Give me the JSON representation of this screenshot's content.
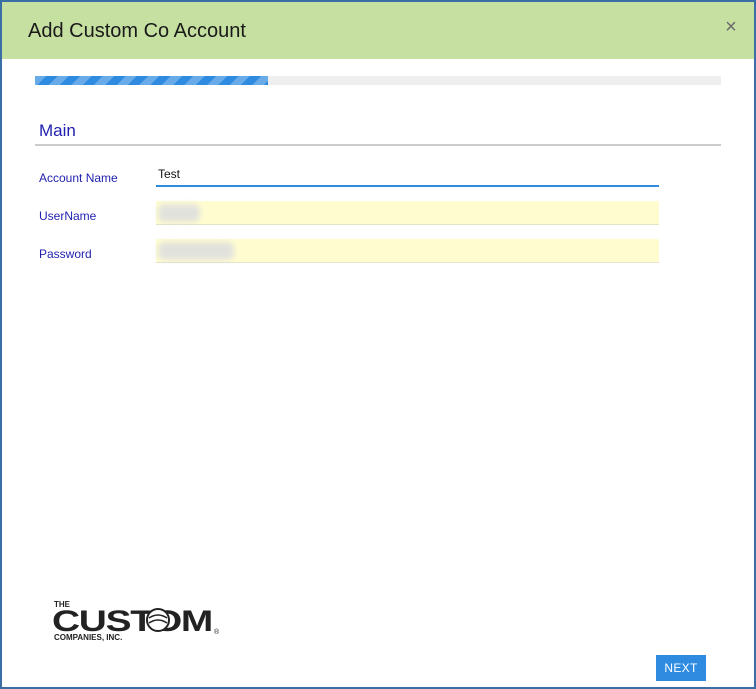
{
  "dialog": {
    "title": "Add Custom Co Account",
    "close_symbol": "×",
    "progress": 0.34
  },
  "section": {
    "title": "Main"
  },
  "form": {
    "account_name": {
      "label": "Account Name",
      "value": "Test"
    },
    "username": {
      "label": "UserName",
      "value": ""
    },
    "password": {
      "label": "Password",
      "value": ""
    }
  },
  "logo": {
    "line1": "THE",
    "line2": "CUSTOM",
    "line3": "COMPANIES, INC.",
    "mark": "®"
  },
  "footer": {
    "next_label": "NEXT"
  },
  "colors": {
    "header_bg": "#c5e0a0",
    "accent": "#2f8be0",
    "label": "#1f1fb0",
    "autofill_bg": "#fffdd0"
  },
  "icons": {
    "close": "close-icon"
  }
}
